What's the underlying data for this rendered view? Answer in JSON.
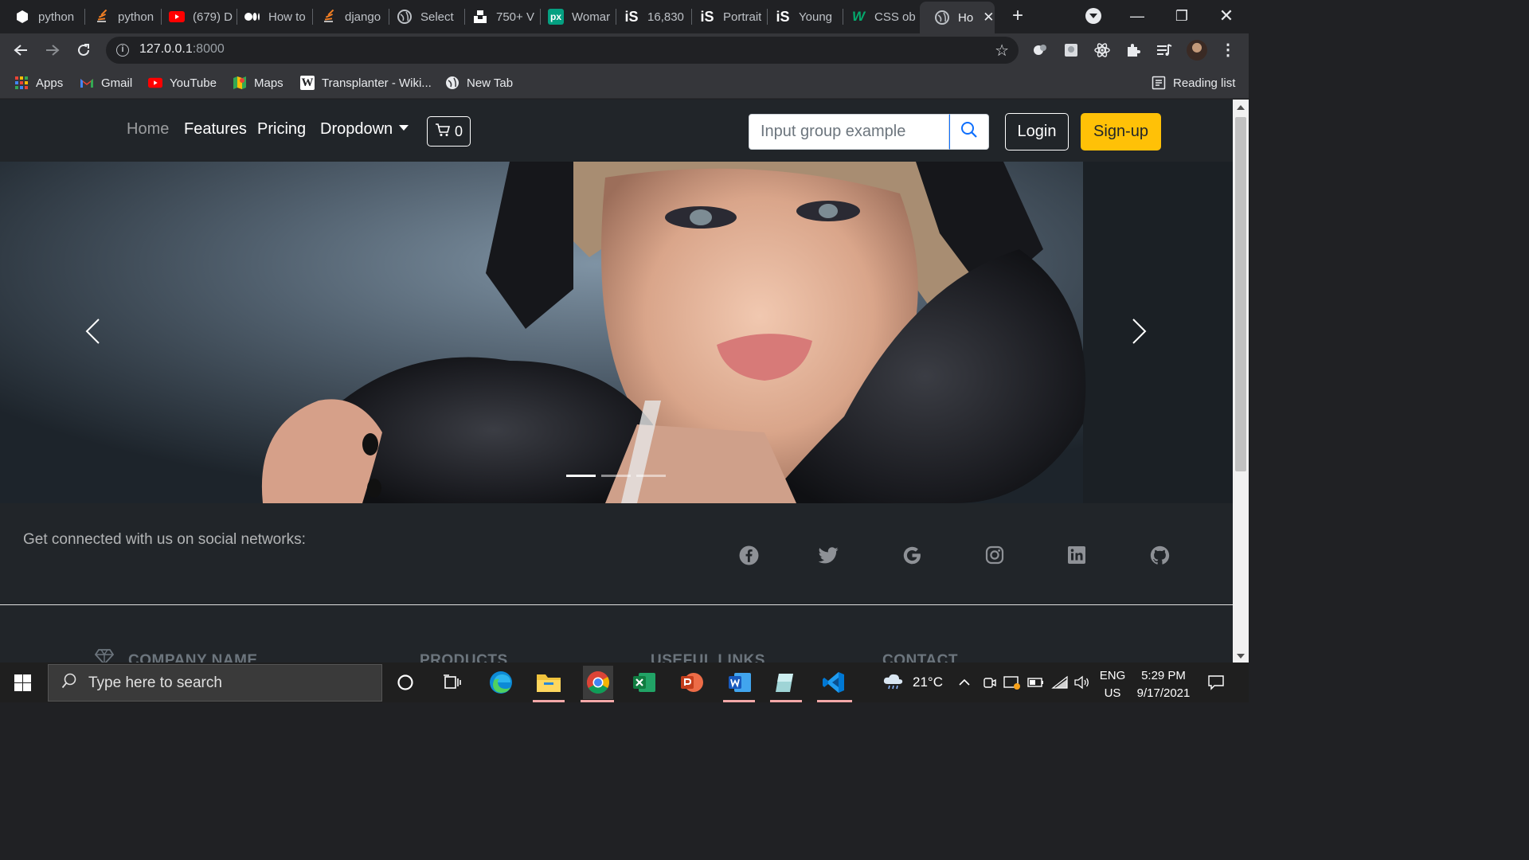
{
  "browser": {
    "tabs": [
      {
        "title": "python",
        "favicon": "box-icon",
        "color": "#ffffff"
      },
      {
        "title": "python",
        "favicon": "stackoverflow-icon",
        "color": "#f48024"
      },
      {
        "title": "(679) D",
        "favicon": "youtube-icon",
        "color": "#ff0000"
      },
      {
        "title": "How to",
        "favicon": "medium-icon",
        "color": "#ffffff"
      },
      {
        "title": "django",
        "favicon": "stackoverflow-icon",
        "color": "#f48024"
      },
      {
        "title": "Select",
        "favicon": "globe-icon",
        "color": "#bdc1c6"
      },
      {
        "title": "750+ V",
        "favicon": "unsplash-icon",
        "color": "#ffffff"
      },
      {
        "title": "Womar",
        "favicon": "pexels-icon",
        "color": "#05a081"
      },
      {
        "title": "16,830",
        "favicon": "istock-icon",
        "color": "#ffffff"
      },
      {
        "title": "Portrait",
        "favicon": "istock-icon",
        "color": "#ffffff"
      },
      {
        "title": "Young",
        "favicon": "istock-icon",
        "color": "#ffffff"
      },
      {
        "title": "CSS ob",
        "favicon": "w3schools-icon",
        "color": "#04aa6d"
      },
      {
        "title": "Ho",
        "favicon": "globe-icon",
        "color": "#bdc1c6",
        "active": true
      }
    ],
    "url_host": "127.0.0.1",
    "url_port": ":8000",
    "bookmarks": [
      {
        "label": "Apps"
      },
      {
        "label": "Gmail"
      },
      {
        "label": "YouTube"
      },
      {
        "label": "Maps"
      },
      {
        "label": "Transplanter - Wiki..."
      },
      {
        "label": "New Tab"
      }
    ],
    "reading_list": "Reading list"
  },
  "site": {
    "nav": {
      "home": "Home",
      "features": "Features",
      "pricing": "Pricing",
      "dropdown": "Dropdown",
      "cart_count": "0"
    },
    "search_placeholder": "Input group example",
    "login": "Login",
    "signup": "Sign-up",
    "accent": "#ffc107",
    "carousel": {
      "slide_count": 3,
      "active_index": 0
    },
    "social": {
      "text": "Get connected with us on social networks:",
      "icons": [
        "facebook-icon",
        "twitter-icon",
        "google-icon",
        "instagram-icon",
        "linkedin-icon",
        "github-icon"
      ]
    },
    "footer": {
      "company": "COMPANY NAME",
      "products": "PRODUCTS",
      "useful_links": "USEFUL LINKS",
      "contact": "CONTACT"
    }
  },
  "taskbar": {
    "search_placeholder": "Type here to search",
    "weather": "21°C",
    "lang_top": "ENG",
    "lang_bottom": "US",
    "time": "5:29 PM",
    "date": "9/17/2021"
  }
}
